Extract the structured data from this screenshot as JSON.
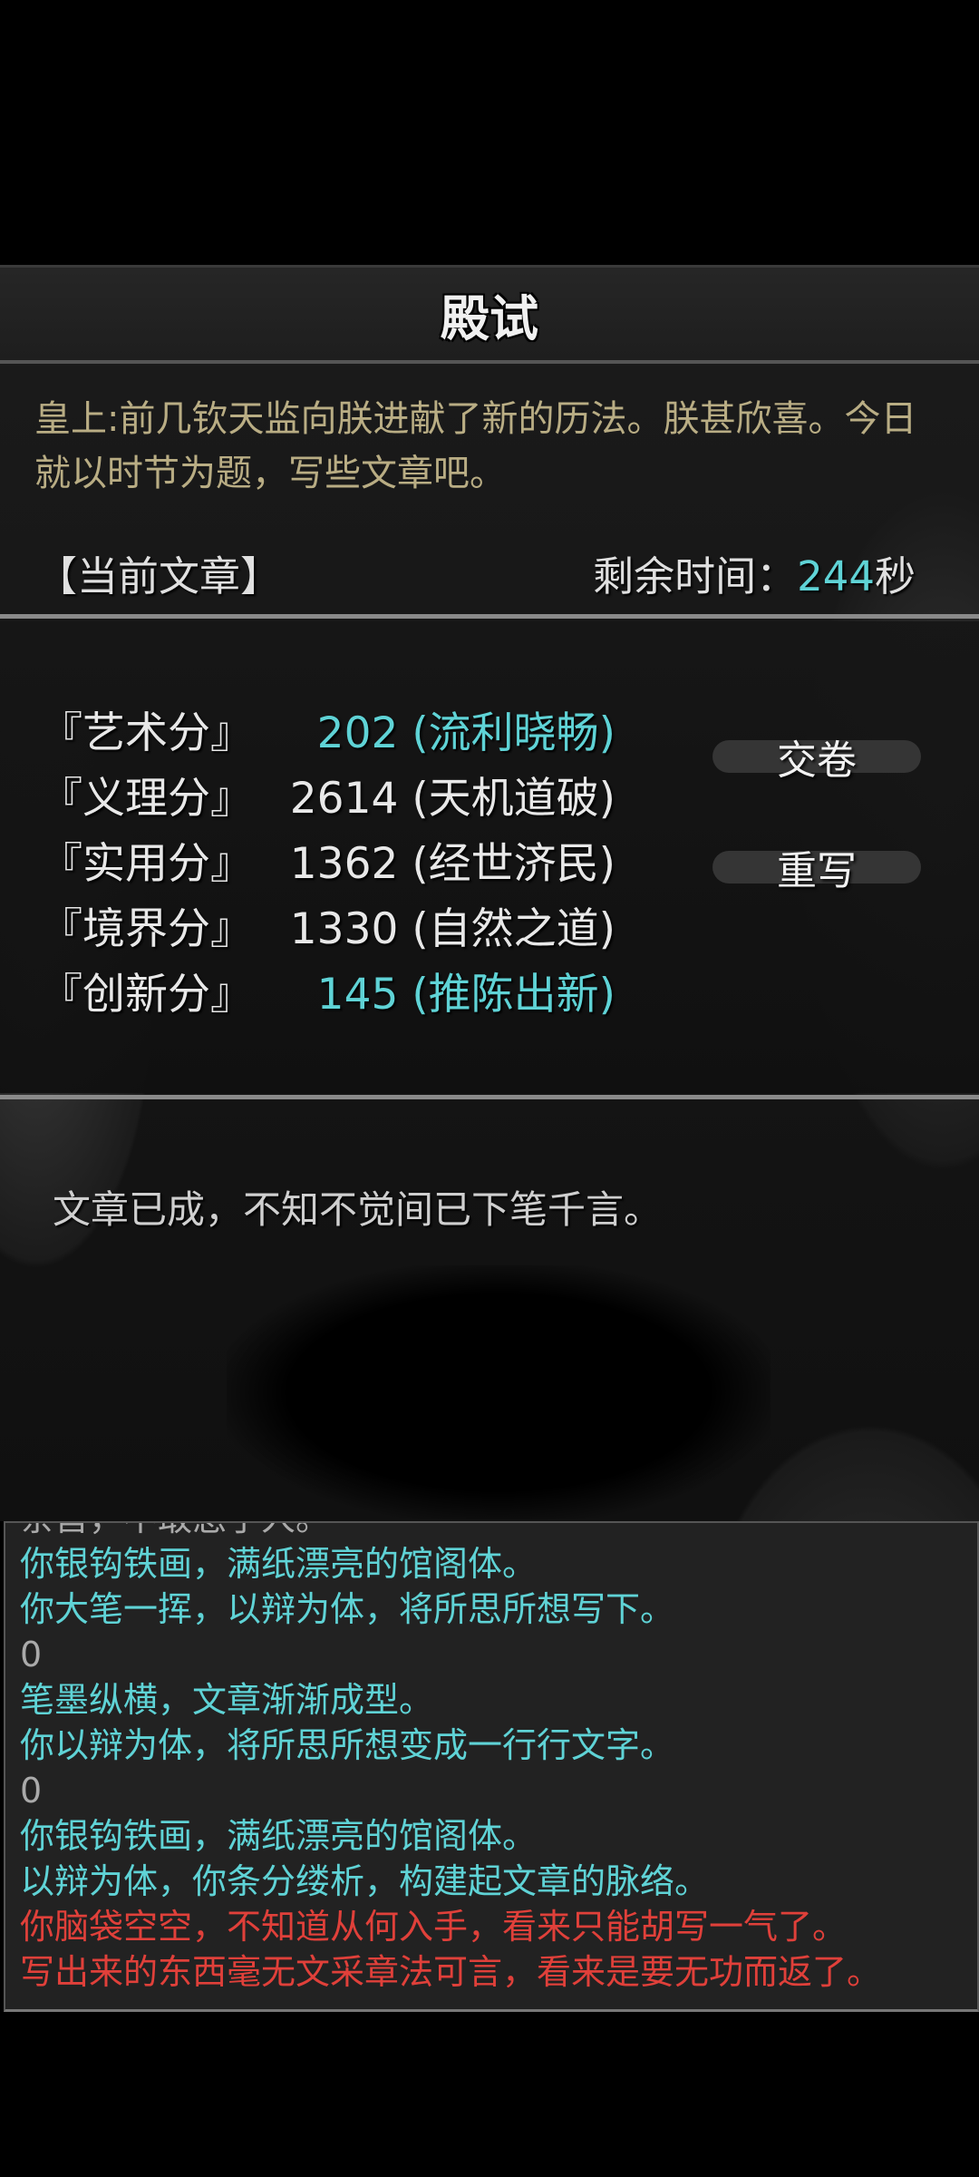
{
  "title": "殿试",
  "emperor_speech": "皇上:前几钦天监向朕进献了新的历法。朕甚欣喜。今日就以时节为题，写些文章吧。",
  "current_essay_label": "【当前文章】",
  "timer": {
    "label": "剩余时间：",
    "value": "244",
    "unit": "秒"
  },
  "scores": [
    {
      "label": "『艺术分』",
      "value": "202 (流利晓畅)",
      "highlight": true
    },
    {
      "label": "『义理分』",
      "value": "2614 (天机道破)",
      "highlight": false
    },
    {
      "label": "『实用分』",
      "value": "1362 (经世济民)",
      "highlight": false
    },
    {
      "label": "『境界分』",
      "value": "1330 (自然之道)",
      "highlight": false
    },
    {
      "label": "『创新分』",
      "value": "145 (推陈出新)",
      "highlight": true
    }
  ],
  "buttons": {
    "submit": "交卷",
    "rewrite": "重写"
  },
  "essay_status": "文章已成，不知不觉间已下笔千言。",
  "log": [
    {
      "text": "亲旨，不敢怠了人。",
      "color": "gray"
    },
    {
      "text": "你银钩铁画，满纸漂亮的馆阁体。",
      "color": "cyan"
    },
    {
      "text": "你大笔一挥，以辩为体，将所思所想写下。",
      "color": "cyan"
    },
    {
      "text": "0",
      "color": "gray"
    },
    {
      "text": "笔墨纵横，文章渐渐成型。",
      "color": "cyan"
    },
    {
      "text": "你以辩为体，将所思所想变成一行行文字。",
      "color": "cyan"
    },
    {
      "text": "0",
      "color": "gray"
    },
    {
      "text": "你银钩铁画，满纸漂亮的馆阁体。",
      "color": "cyan"
    },
    {
      "text": "以辩为体，你条分缕析，构建起文章的脉络。",
      "color": "cyan"
    },
    {
      "text": "你脑袋空空，不知道从何入手，看来只能胡写一气了。",
      "color": "red"
    },
    {
      "text": "写出来的东西毫无文采章法可言，看来是要无功而返了。",
      "color": "red"
    }
  ],
  "colors": {
    "accent": "#5fd3d6",
    "warning": "#e0403a",
    "speech": "#b9ad84"
  }
}
